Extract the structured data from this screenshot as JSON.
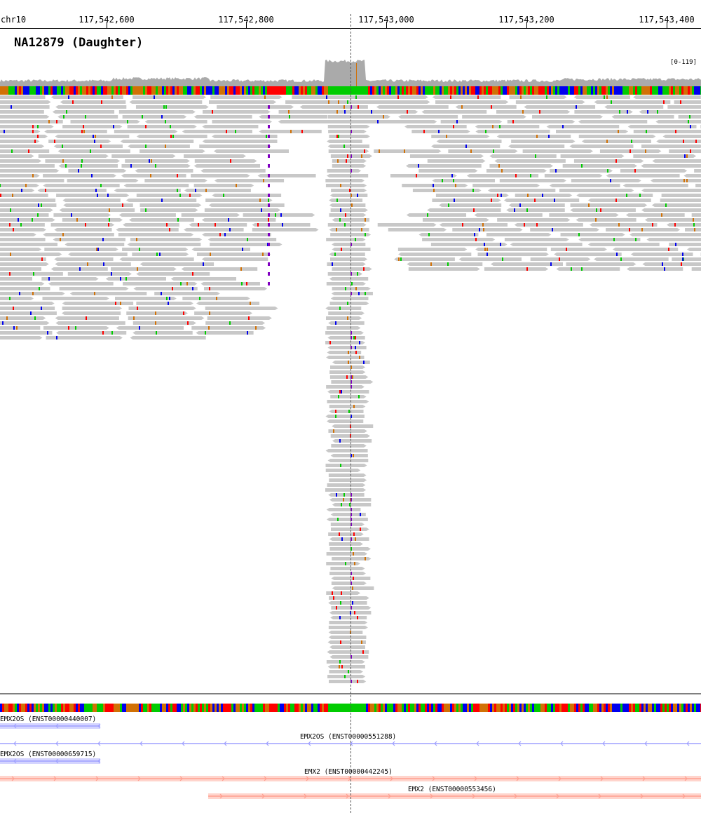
{
  "ruler": {
    "chromosome": "chr10",
    "ticks": [
      {
        "label": "117,542,600",
        "pos": 117542600
      },
      {
        "label": "117,542,800",
        "pos": 117542800
      },
      {
        "label": "117,543,000",
        "pos": 117543000
      },
      {
        "label": "117,543,200",
        "pos": 117543200
      },
      {
        "label": "117,543,400",
        "pos": 117543400
      }
    ]
  },
  "alignment_track": {
    "sample_name": "NA12879 (Daughter)",
    "coverage_range": "[0-119]"
  },
  "gene_track": {
    "transcripts": [
      {
        "label": "EMX2OS (ENST00000440007)",
        "color": "#9fa0ff",
        "strand": "minus"
      },
      {
        "label": "EMX2OS (ENST00000551288)",
        "color": "#9fa0ff",
        "strand": "minus"
      },
      {
        "label": "EMX2OS (ENST00000659715)",
        "color": "#9fa0ff",
        "strand": "minus"
      },
      {
        "label": "EMX2 (ENST00000442245)",
        "color": "#ff9f8f",
        "strand": "plus"
      },
      {
        "label": "EMX2 (ENST00000553456)",
        "color": "#ff9f8f",
        "strand": "plus"
      }
    ]
  },
  "colors": {
    "coverage": "#aaaaaa",
    "read": "#c8c8c8",
    "base_A": "#00cc00",
    "base_C": "#0000ee",
    "base_G": "#d17105",
    "base_T": "#ff0000",
    "insertion": "#8000c0"
  }
}
